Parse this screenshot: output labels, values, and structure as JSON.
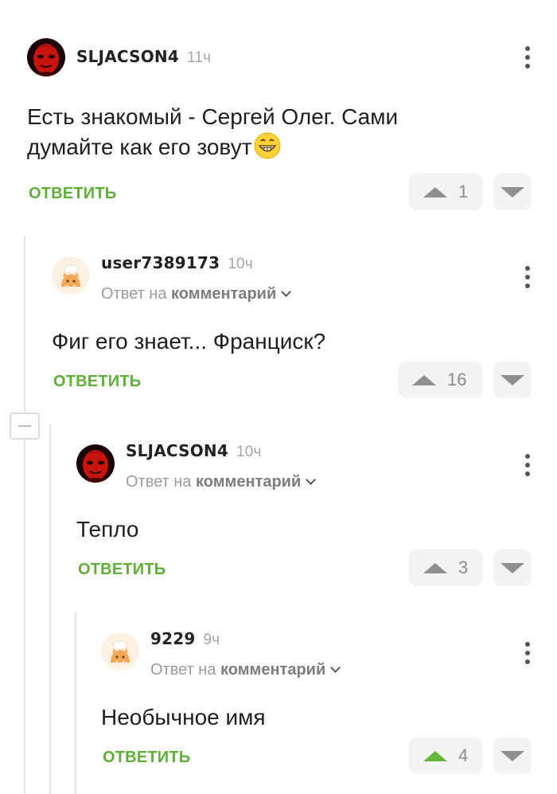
{
  "colors": {
    "accent": "#5fae37",
    "upvote_active": "#63b53b",
    "muted": "#a5a5a5"
  },
  "icons": {
    "more": "kebab-vertical-icon",
    "collapse": "minus-icon",
    "upvote": "triangle-up-icon",
    "downvote": "triangle-down-icon",
    "chevron": "chevron-down-icon",
    "emoji": "grinning-emoji-icon"
  },
  "comments": [
    {
      "username": "SLJACSON4",
      "time": "11ч",
      "reply_to": null,
      "text_line1": "Есть знакомый - Сергей Олег. Сами",
      "text_line2": "думайте как его зовут",
      "reply_label": "ОТВЕТИТЬ",
      "votes": "1",
      "avatar": "red-face-avatar",
      "upvoted": false
    },
    {
      "username": "user7389173",
      "time": "10ч",
      "reply_to_prefix": "Ответ на",
      "reply_to_target": "комментарий",
      "text": "Фиг его знает... Франциск?",
      "reply_label": "ОТВЕТИТЬ",
      "votes": "16",
      "avatar": "default-cat-avatar",
      "upvoted": false
    },
    {
      "username": "SLJACSON4",
      "time": "10ч",
      "reply_to_prefix": "Ответ на",
      "reply_to_target": "комментарий",
      "text": "Тепло",
      "reply_label": "ОТВЕТИТЬ",
      "votes": "3",
      "avatar": "red-face-avatar",
      "upvoted": false
    },
    {
      "username": "9229",
      "time": "9ч",
      "reply_to_prefix": "Ответ на",
      "reply_to_target": "комментарий",
      "text": "Необычное имя",
      "reply_label": "ОТВЕТИТЬ",
      "votes": "4",
      "avatar": "default-cat-avatar",
      "upvoted": true
    }
  ]
}
